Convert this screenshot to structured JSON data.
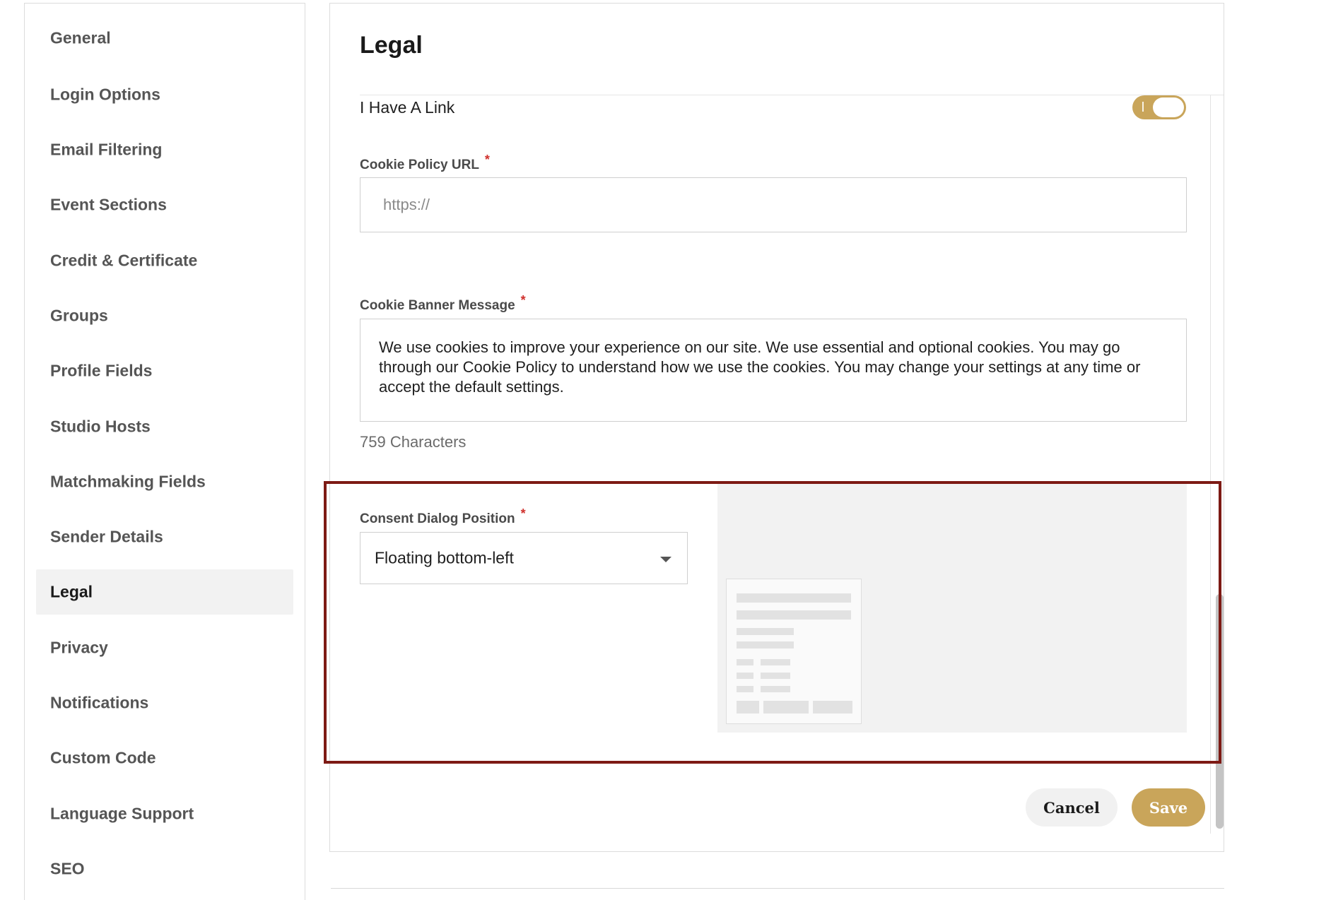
{
  "sidebar": {
    "items": [
      {
        "label": "General"
      },
      {
        "label": "Login Options"
      },
      {
        "label": "Email Filtering"
      },
      {
        "label": "Event Sections"
      },
      {
        "label": "Credit & Certificate"
      },
      {
        "label": "Groups"
      },
      {
        "label": "Profile Fields"
      },
      {
        "label": "Studio Hosts"
      },
      {
        "label": "Matchmaking Fields"
      },
      {
        "label": "Sender Details"
      },
      {
        "label": "Legal"
      },
      {
        "label": "Privacy"
      },
      {
        "label": "Notifications"
      },
      {
        "label": "Custom Code"
      },
      {
        "label": "Language Support"
      },
      {
        "label": "SEO"
      }
    ],
    "active": "Legal"
  },
  "main": {
    "title": "Legal",
    "link_toggle": {
      "label": "I Have A Link",
      "on": true
    },
    "cookie_policy_url": {
      "label": "Cookie Policy URL",
      "required_mark": "*",
      "placeholder": "https://",
      "value": ""
    },
    "cookie_banner_message": {
      "label": "Cookie Banner Message",
      "required_mark": "*",
      "value": "We use cookies to improve your experience on our site. We use essential and optional cookies. You may go through our Cookie Policy to understand how we use the cookies. You may change your settings at any time or accept the default settings.",
      "char_count": "759 Characters"
    },
    "consent_dialog_position": {
      "label": "Consent Dialog Position",
      "required_mark": "*",
      "selected": "Floating bottom-left"
    },
    "actions": {
      "cancel_label": "Cancel",
      "save_label": "Save"
    }
  },
  "colors": {
    "accent": "#c9a55a",
    "highlight_border": "#7d1a14",
    "required": "#d0312d"
  }
}
